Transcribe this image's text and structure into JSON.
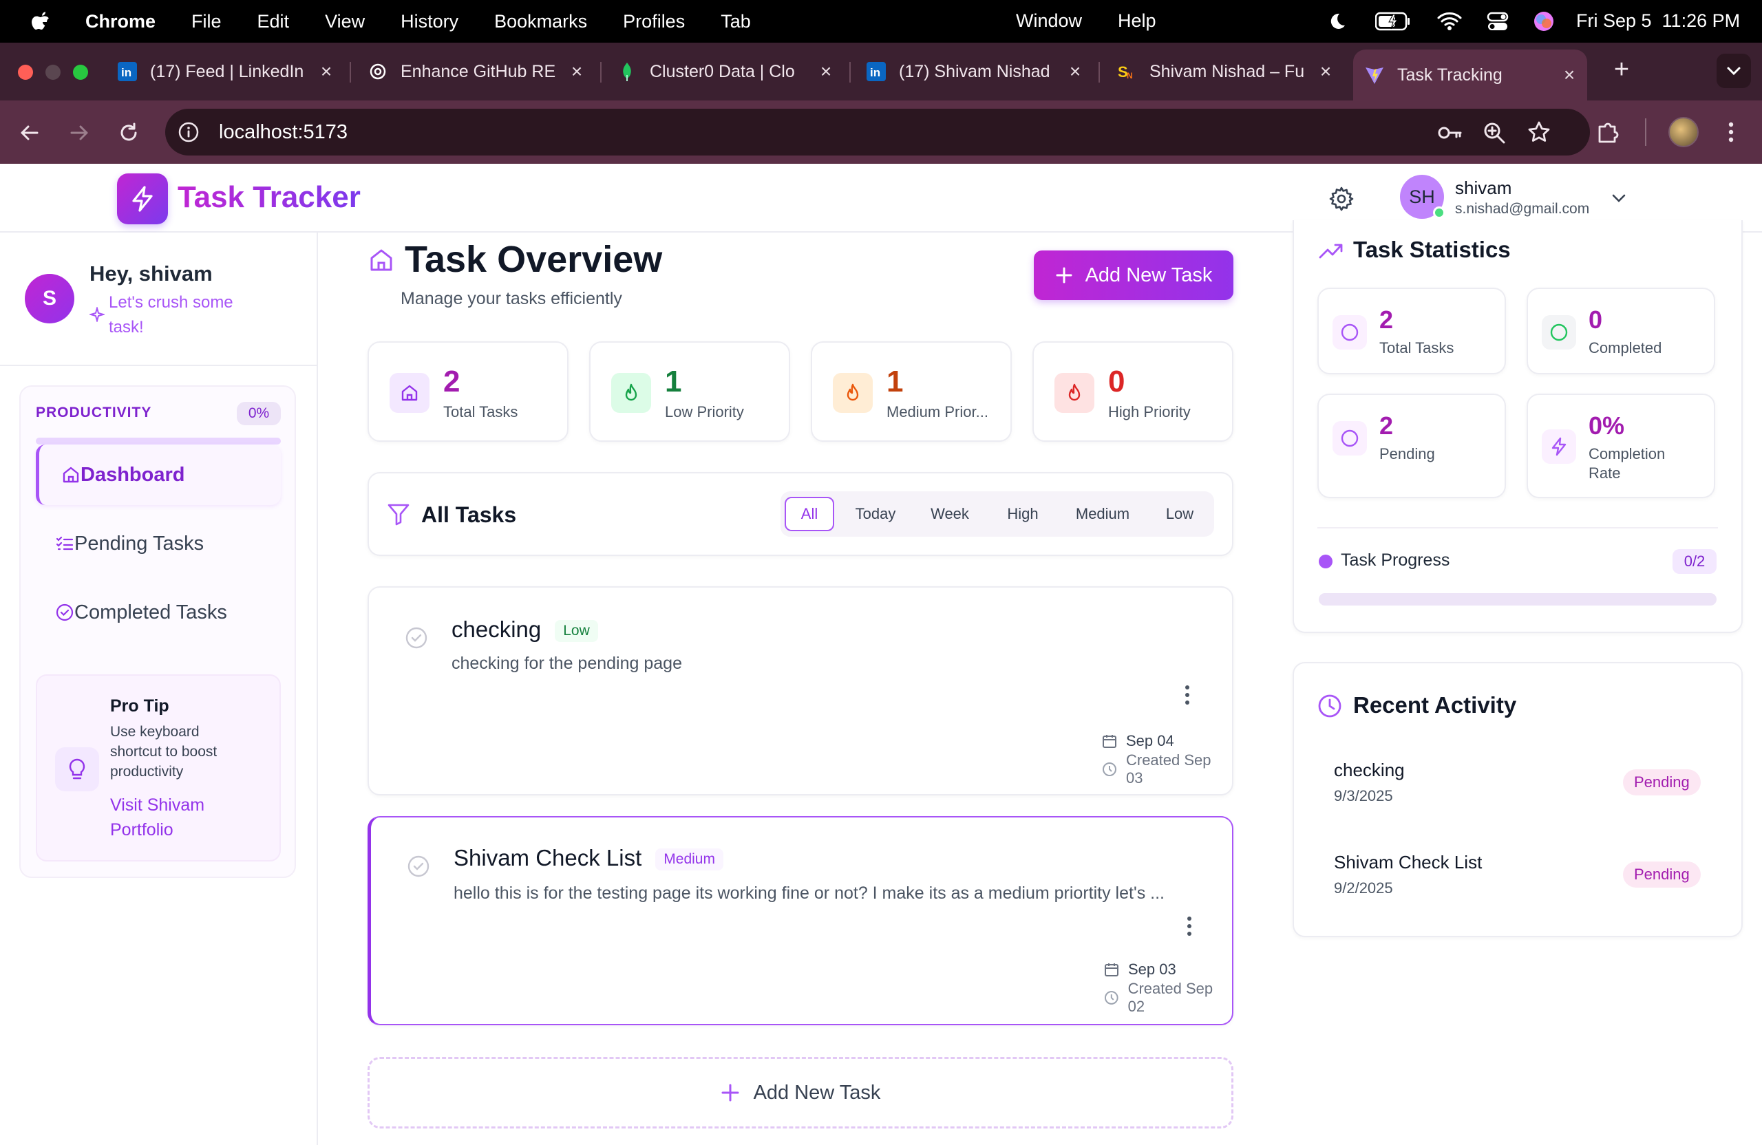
{
  "menubar": {
    "app": "Chrome",
    "items": [
      "File",
      "Edit",
      "View",
      "History",
      "Bookmarks",
      "Profiles",
      "Tab"
    ],
    "right_items": [
      "Window",
      "Help"
    ],
    "datetime": "Fri Sep 5  11:26 PM"
  },
  "browser": {
    "tabs": [
      {
        "title": "(17) Feed | LinkedIn",
        "icon": "linkedin-icon"
      },
      {
        "title": "Enhance GitHub RE",
        "icon": "openai-icon"
      },
      {
        "title": "Cluster0 Data | Clo",
        "icon": "mongodb-leaf-icon"
      },
      {
        "title": "(17) Shivam Nishad",
        "icon": "linkedin-icon"
      },
      {
        "title": "Shivam Nishad – Fu",
        "icon": "portfolio-icon"
      },
      {
        "title": "Task Tracking",
        "icon": "vite-icon",
        "active": true
      }
    ],
    "url": "localhost:5173"
  },
  "app": {
    "title": "Task Tracker",
    "user": {
      "initials": "SH",
      "name": "shivam",
      "email": "s.nishad@gmail.com"
    }
  },
  "sidebar": {
    "avatar_letter": "S",
    "greeting": "Hey, shivam",
    "tagline_line1": "Let's crush some",
    "tagline_line2": "task!",
    "productivity_label": "PRODUCTIVITY",
    "productivity_value": "0%",
    "productivity_fraction": 0,
    "nav": [
      {
        "label": "Dashboard",
        "icon": "home-icon",
        "active": true
      },
      {
        "label": "Pending Tasks",
        "icon": "list-check-icon"
      },
      {
        "label": "Completed Tasks",
        "icon": "circle-check-icon"
      }
    ],
    "protip": {
      "title": "Pro Tip",
      "line1": "Use keyboard",
      "line2": "shortcut to boost",
      "line3": "productivity",
      "link_line1": "Visit Shivam",
      "link_line2": "Portfolio"
    }
  },
  "overview": {
    "title": "Task Overview",
    "subtitle": "Manage your tasks efficiently",
    "add_button": "Add New Task",
    "stats": [
      {
        "value": "2",
        "label": "Total Tasks",
        "color": "#a21caf"
      },
      {
        "value": "1",
        "label": "Low Priority",
        "color": "#15803d"
      },
      {
        "value": "1",
        "label": "Medium Prior...",
        "color": "#c2410c"
      },
      {
        "value": "0",
        "label": "High Priority",
        "color": "#dc2626"
      }
    ]
  },
  "tasks_panel": {
    "title": "All Tasks",
    "filters": [
      "All",
      "Today",
      "Week",
      "High",
      "Medium",
      "Low"
    ],
    "selected_filter": "All"
  },
  "tasks": [
    {
      "name": "checking",
      "priority": "Low",
      "description": "checking for the pending page",
      "due": "Sep 04",
      "created": "Created Sep 03"
    },
    {
      "name": "Shivam Check List",
      "priority": "Medium",
      "description": "hello this is for the testing page its working fine or not? I make its as a medium priortity let's ...",
      "due": "Sep 03",
      "created": "Created Sep 02"
    }
  ],
  "add_task_footer": "Add New Task",
  "statistics": {
    "title": "Task Statistics",
    "cards": [
      {
        "value": "2",
        "label_line1": "Total Tasks",
        "label_line2": ""
      },
      {
        "value": "0",
        "label_line1": "Completed",
        "label_line2": ""
      },
      {
        "value": "2",
        "label_line1": "Pending",
        "label_line2": ""
      },
      {
        "value": "0%",
        "label_line1": "Completion",
        "label_line2": "Rate"
      }
    ],
    "progress_label": "Task Progress",
    "progress_value": "0/2",
    "progress_fraction": 0
  },
  "recent_activity": {
    "title": "Recent Activity",
    "items": [
      {
        "name": "checking",
        "date": "9/3/2025",
        "status": "Pending"
      },
      {
        "name": "Shivam Check List",
        "date": "9/2/2025",
        "status": "Pending"
      }
    ]
  }
}
